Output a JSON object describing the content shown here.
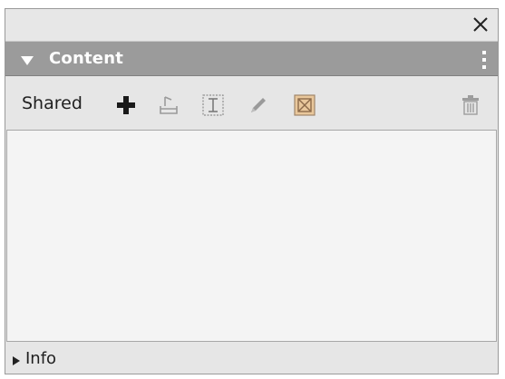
{
  "window": {
    "close_icon": "close-x-icon"
  },
  "header": {
    "title": "Content",
    "collapse_icon": "triangle-down-icon",
    "menu_icon": "vertical-dots-icon",
    "background_color": "#9b9b9b"
  },
  "toolbar": {
    "label": "Shared",
    "tools": [
      {
        "name": "add",
        "icon": "plus-icon"
      },
      {
        "name": "import",
        "icon": "import-tray-icon"
      },
      {
        "name": "text-frame",
        "icon": "text-frame-icon"
      },
      {
        "name": "edit",
        "icon": "pencil-icon"
      },
      {
        "name": "placeholder",
        "icon": "crossed-box-icon"
      },
      {
        "name": "delete",
        "icon": "trash-icon"
      }
    ]
  },
  "content": {
    "items": []
  },
  "footer": {
    "label": "Info",
    "expand_icon": "triangle-right-icon"
  }
}
